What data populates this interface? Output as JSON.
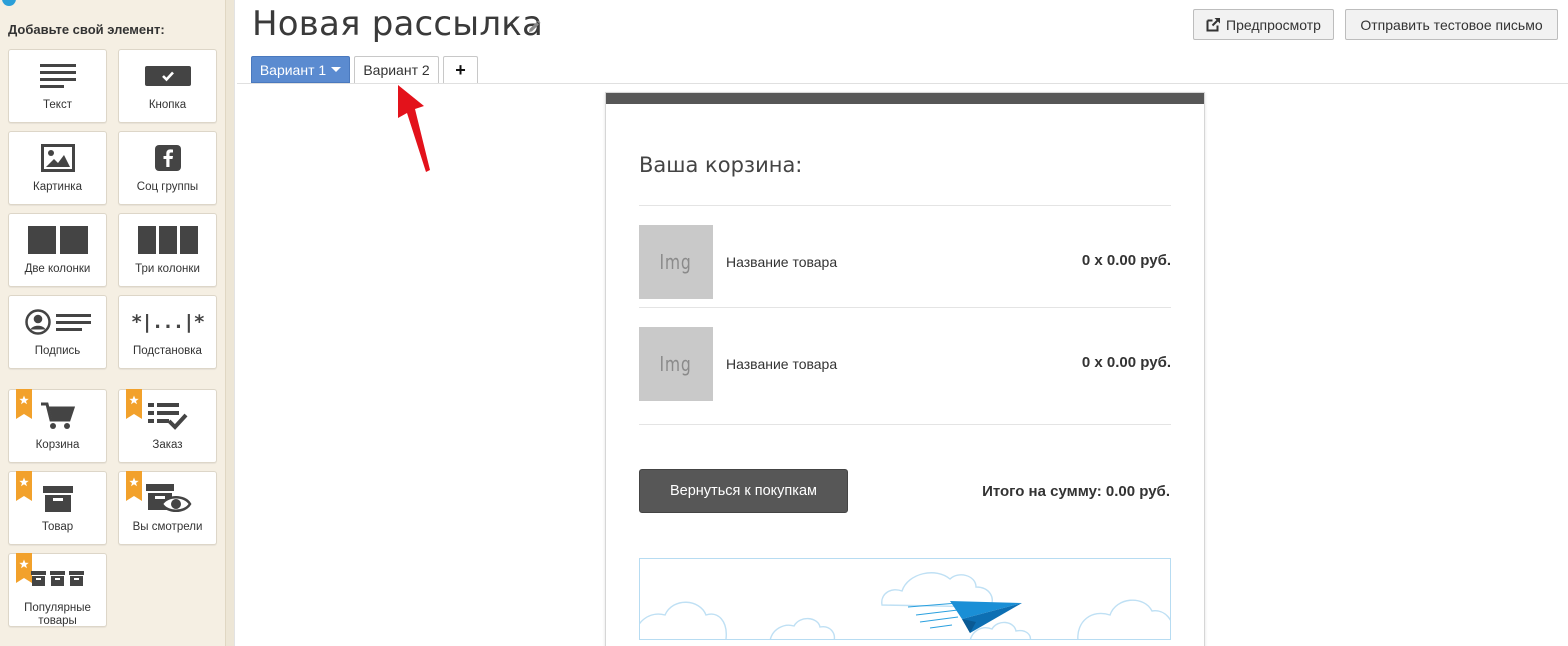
{
  "sidebar": {
    "title": "Добавьте свой элемент:",
    "elements": [
      {
        "label": "Текст",
        "icon": "text-lines-icon",
        "premium": false
      },
      {
        "label": "Кнопка",
        "icon": "button-check-icon",
        "premium": false
      },
      {
        "label": "Картинка",
        "icon": "image-icon",
        "premium": false
      },
      {
        "label": "Соц группы",
        "icon": "facebook-icon",
        "premium": false
      },
      {
        "label": "Две колонки",
        "icon": "two-columns-icon",
        "premium": false
      },
      {
        "label": "Три колонки",
        "icon": "three-columns-icon",
        "premium": false
      },
      {
        "label": "Подпись",
        "icon": "signature-icon",
        "premium": false
      },
      {
        "label": "Подстановка",
        "icon": "substitution-icon",
        "premium": false
      },
      {
        "label": "Корзина",
        "icon": "cart-icon",
        "premium": true
      },
      {
        "label": "Заказ",
        "icon": "order-list-icon",
        "premium": true
      },
      {
        "label": "Товар",
        "icon": "product-box-icon",
        "premium": true
      },
      {
        "label": "Вы смотрели",
        "icon": "viewed-eye-icon",
        "premium": true
      },
      {
        "label": "Популярные товары",
        "icon": "popular-boxes-icon",
        "premium": true
      }
    ],
    "substitution_glyph": "*|...|*"
  },
  "header": {
    "title": "Новая рассылка",
    "preview_label": "Предпросмотр",
    "test_email_label": "Отправить тестовое письмо"
  },
  "tabs": {
    "variant1_label": "Вариант 1",
    "variant2_label": "Вариант 2",
    "add_label": "+"
  },
  "email": {
    "cart_heading": "Ваша корзина:",
    "products": [
      {
        "image_placeholder": "Img",
        "name": "Название товара",
        "price": "0 x 0.00 руб."
      },
      {
        "image_placeholder": "Img",
        "name": "Название товара",
        "price": "0 x 0.00 руб."
      }
    ],
    "back_button_label": "Вернуться к покупкам",
    "total_label": "Итого на сумму: 0.00 руб."
  },
  "colors": {
    "accent_blue": "#5b8bd0",
    "sidebar_bg": "#f5efe3",
    "premium_ribbon": "#f2a12b",
    "email_dark": "#575757",
    "banner_plane": "#1a8fd6",
    "annotation_arrow": "#e3121b"
  }
}
